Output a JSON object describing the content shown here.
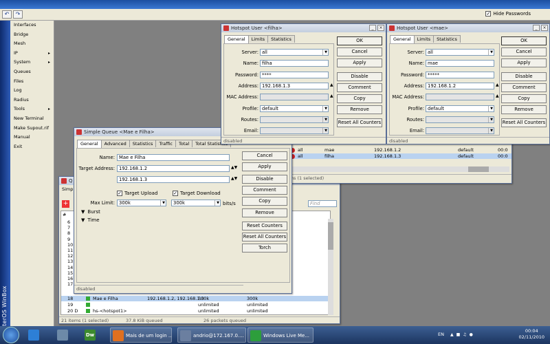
{
  "toolbar": {
    "undo_icon": "undo-icon",
    "redo_icon": "redo-icon",
    "hide_passwords": "Hide Passwords",
    "hide_passwords_checked": true
  },
  "brand": {
    "vertical": "RouterOS WinBox"
  },
  "menu": {
    "items": [
      {
        "label": "Interfaces",
        "sub": false
      },
      {
        "label": "Bridge",
        "sub": false
      },
      {
        "label": "Mesh",
        "sub": false
      },
      {
        "label": "IP",
        "sub": true
      },
      {
        "label": "System",
        "sub": true
      },
      {
        "label": "Queues",
        "sub": false
      },
      {
        "label": "Files",
        "sub": false
      },
      {
        "label": "Log",
        "sub": false
      },
      {
        "label": "Radius",
        "sub": false
      },
      {
        "label": "Tools",
        "sub": true
      },
      {
        "label": "New Terminal",
        "sub": false
      },
      {
        "label": "Make Supout.rif",
        "sub": false
      },
      {
        "label": "Manual",
        "sub": false
      },
      {
        "label": "Exit",
        "sub": false
      }
    ]
  },
  "hs_filha": {
    "title": "Hotspot User <filha>",
    "tabs": [
      "General",
      "Limits",
      "Statistics"
    ],
    "fields": [
      {
        "label": "Server:",
        "value": "all"
      },
      {
        "label": "Name:",
        "value": "filha"
      },
      {
        "label": "Password:",
        "value": "****"
      },
      {
        "label": "Address:",
        "value": "192.168.1.3"
      },
      {
        "label": "MAC Address:",
        "value": ""
      },
      {
        "label": "Profile:",
        "value": "default"
      },
      {
        "label": "Routes:",
        "value": ""
      },
      {
        "label": "Email:",
        "value": ""
      }
    ],
    "buttons": [
      "OK",
      "Cancel",
      "Apply",
      "Disable",
      "Comment",
      "Copy",
      "Remove",
      "Reset All Counters"
    ],
    "status": "disabled"
  },
  "hs_mae": {
    "title": "Hotspot User <mae>",
    "tabs": [
      "General",
      "Limits",
      "Statistics"
    ],
    "fields": [
      {
        "label": "Server:",
        "value": "all"
      },
      {
        "label": "Name:",
        "value": "mae"
      },
      {
        "label": "Password:",
        "value": "*****"
      },
      {
        "label": "Address:",
        "value": "192.168.1.2"
      },
      {
        "label": "MAC Address:",
        "value": ""
      },
      {
        "label": "Profile:",
        "value": "default"
      },
      {
        "label": "Routes:",
        "value": ""
      },
      {
        "label": "Email:",
        "value": ""
      }
    ],
    "buttons": [
      "OK",
      "Cancel",
      "Apply",
      "Disable",
      "Comment",
      "Copy",
      "Remove",
      "Reset All Counters"
    ],
    "status": "disabled"
  },
  "hs_list": {
    "rows": [
      {
        "server": "all",
        "name": "mae",
        "address": "192.168.1.2",
        "profile": "default",
        "uptime": "00:0"
      },
      {
        "server": "all",
        "name": "filha",
        "address": "192.168.1.3",
        "profile": "default",
        "uptime": "00:0"
      }
    ],
    "status": "42 items (1 selected)"
  },
  "simple_queue": {
    "title": "Simple Queue <Mae e Filha>",
    "tabs": [
      "General",
      "Advanced",
      "Statistics",
      "Traffic",
      "Total",
      "Total Statistics"
    ],
    "name_label": "Name:",
    "name": "Mae e Filha",
    "target_label": "Target Address:",
    "target1": "192.168.1.2",
    "target2": "192.168.1.3",
    "target_upload": "Target Upload",
    "target_download": "Target Download",
    "max_limit_label": "Max Limit:",
    "max_up": "300k",
    "max_down": "300k",
    "unit": "bits/s",
    "burst": "Burst",
    "time": "Time",
    "buttons": [
      "Cancel",
      "Apply",
      "Disable",
      "Comment",
      "Copy",
      "Remove",
      "Reset Counters",
      "Reset All Counters",
      "Torch"
    ],
    "status": "disabled"
  },
  "queue_list": {
    "title_fragment": "Q",
    "tab_fragment": "Simp",
    "hash": "#",
    "find_placeholder": "Find",
    "numbers": [
      "6",
      "7",
      "8",
      "9",
      "10",
      "11",
      "12",
      "13",
      "14",
      "15",
      "16",
      "17"
    ],
    "rows": [
      {
        "num": "18",
        "name": "Mae e Filha",
        "target": "192.168.1.2, 192.168.1.3",
        "up": "300k",
        "down": "300k",
        "selected": true
      },
      {
        "num": "19",
        "name": "",
        "target": "",
        "up": "unlimited",
        "down": "unlimited",
        "selected": false
      },
      {
        "num": "20 D",
        "name": "hs-<hotspot1>",
        "target": "",
        "up": "unlimited",
        "down": "unlimited",
        "selected": false
      }
    ],
    "status_items": "21 items (1 selected)",
    "status_queued": "37.8 KiB queued",
    "status_packets": "26 packets queued"
  },
  "taskbar": {
    "items": [
      {
        "label": "",
        "icon": "ie-icon"
      },
      {
        "label": "",
        "icon": "network-icon"
      },
      {
        "label": "",
        "icon": "dreamweaver-icon",
        "text": "Dw"
      },
      {
        "label": "Mais de um login ...",
        "icon": "firefox-icon"
      },
      {
        "label": "andrio@172.167.0....",
        "icon": "winbox-icon"
      },
      {
        "label": "Windows Live Me...",
        "icon": "messenger-icon"
      }
    ],
    "lang": "EN",
    "time": "00:04",
    "date": "02/11/2010"
  }
}
